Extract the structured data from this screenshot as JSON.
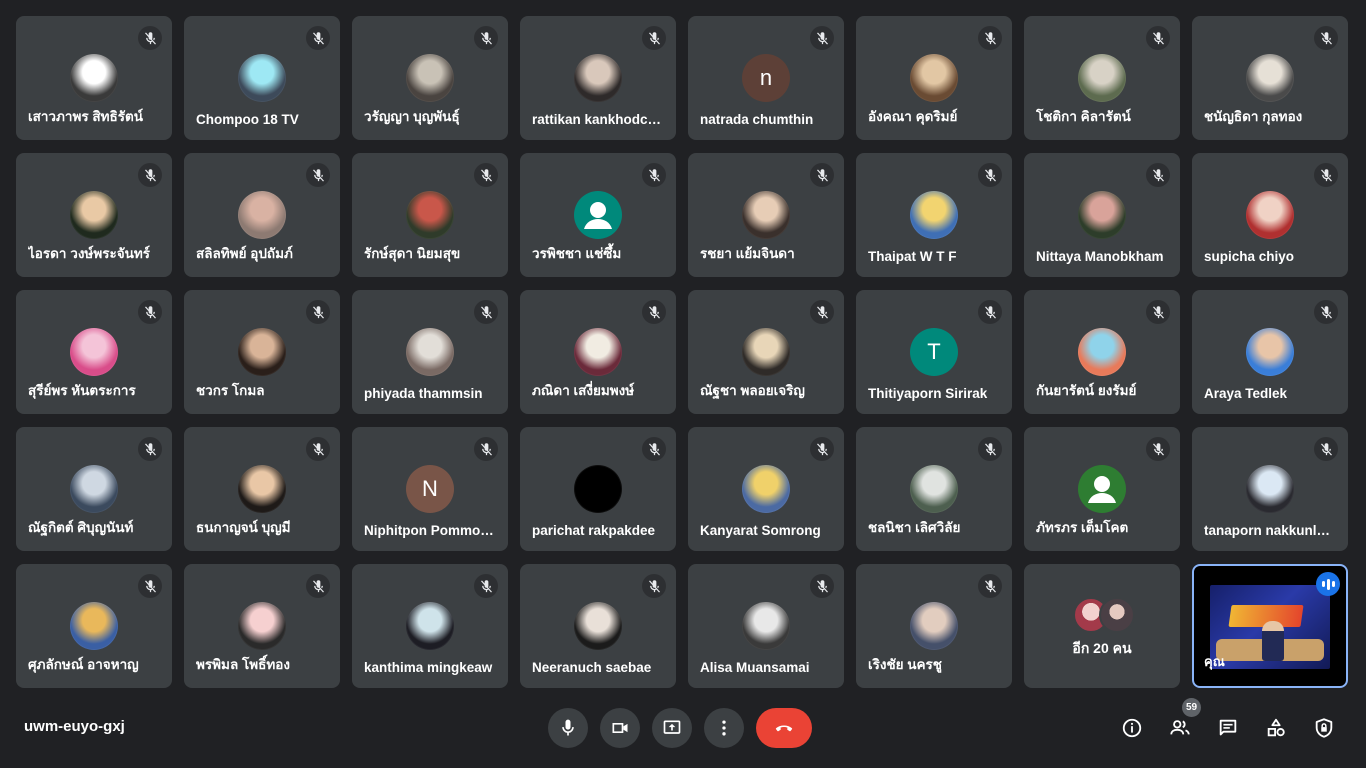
{
  "participants": [
    {
      "name": "เสาวภาพร สิทธิรัตน์",
      "avatar_style": "photo",
      "colors": [
        "#ffffff",
        "#3a3a3a"
      ]
    },
    {
      "name": "Chompoo 18 TV",
      "avatar_style": "photo",
      "colors": [
        "#9ee8f4",
        "#3d4a5a"
      ]
    },
    {
      "name": "วรัญญา บุญพันธุ์",
      "avatar_style": "photo",
      "colors": [
        "#c9c2b6",
        "#4a4440"
      ]
    },
    {
      "name": "rattikan kankhodchai",
      "avatar_style": "photo",
      "colors": [
        "#d9c8bb",
        "#2e2a2a"
      ]
    },
    {
      "name": "natrada chumthin",
      "avatar_style": "letter",
      "letter": "n",
      "colors": [
        "#5d4037",
        "#5d4037"
      ]
    },
    {
      "name": "อังคณา คุดริมย์",
      "avatar_style": "photo",
      "colors": [
        "#e2c7a4",
        "#6a4b33"
      ]
    },
    {
      "name": "โชติกา คิลารัตน์",
      "avatar_style": "photo",
      "colors": [
        "#d8d2c6",
        "#5d6b4f"
      ]
    },
    {
      "name": "ชนัญธิดา กุลทอง",
      "avatar_style": "photo",
      "colors": [
        "#e6e0d6",
        "#4a4a4a"
      ]
    },
    {
      "name": "ไอรดา วงษ์พระจันทร์",
      "avatar_style": "photo",
      "colors": [
        "#e9c9a5",
        "#1f2a1e"
      ]
    },
    {
      "name": "สลิลทิพย์ อุปถัมภ์",
      "avatar_style": "photo",
      "colors": [
        "#d9b2a3",
        "#8d7a72"
      ]
    },
    {
      "name": "รักษ์สุดา นิยมสุข",
      "avatar_style": "photo",
      "colors": [
        "#c9574a",
        "#2f3b2a"
      ]
    },
    {
      "name": "วรพิชชา แช่ซึ้ม",
      "avatar_style": "default",
      "colors": [
        "#00897b",
        "#00897b"
      ]
    },
    {
      "name": "รชยา แย้มจินดา",
      "avatar_style": "photo",
      "colors": [
        "#e7cdb6",
        "#3a302c"
      ]
    },
    {
      "name": "Thaipat W T F",
      "avatar_style": "photo",
      "colors": [
        "#f2d470",
        "#3f6fb5"
      ]
    },
    {
      "name": "Nittaya Manobkham",
      "avatar_style": "photo",
      "colors": [
        "#d9a39a",
        "#2d3d2a"
      ]
    },
    {
      "name": "supicha chiyo",
      "avatar_style": "photo",
      "colors": [
        "#f0d2c5",
        "#b03030"
      ]
    },
    {
      "name": "สุรีย์พร หันตระการ",
      "avatar_style": "photo",
      "colors": [
        "#f4c4d8",
        "#d94d8a"
      ]
    },
    {
      "name": "ชวกร โกมล",
      "avatar_style": "photo",
      "colors": [
        "#d9b498",
        "#2a1f1a"
      ]
    },
    {
      "name": "phiyada thammsin",
      "avatar_style": "photo",
      "colors": [
        "#e2ded8",
        "#7a6a64"
      ]
    },
    {
      "name": "ภณิดา เสงี่ยมพงษ์",
      "avatar_style": "photo",
      "colors": [
        "#f1ece2",
        "#6b2a3a"
      ]
    },
    {
      "name": "ณัฐชา พลอยเจริญ",
      "avatar_style": "photo",
      "colors": [
        "#e8d6b8",
        "#2f2b28"
      ]
    },
    {
      "name": "Thitiyaporn Sirirak",
      "avatar_style": "letter",
      "letter": "T",
      "colors": [
        "#00897b",
        "#00897b"
      ]
    },
    {
      "name": "กันยารัตน์ ยงรัมย์",
      "avatar_style": "photo",
      "colors": [
        "#8fd3ea",
        "#e87a5a"
      ]
    },
    {
      "name": "Araya Tedlek",
      "avatar_style": "photo",
      "colors": [
        "#e8c5a8",
        "#3a7ed8"
      ]
    },
    {
      "name": "ณัฐกิตต์ ศิบุญนันท์",
      "avatar_style": "photo",
      "colors": [
        "#cfd8e2",
        "#3b4a5e"
      ]
    },
    {
      "name": "ธนกาญจน์ บุญมี",
      "avatar_style": "photo",
      "colors": [
        "#e9c7a6",
        "#1e1a18"
      ]
    },
    {
      "name": "Niphitpon Pommongkol",
      "avatar_style": "letter",
      "letter": "N",
      "colors": [
        "#795548",
        "#795548"
      ]
    },
    {
      "name": "parichat rakpakdee",
      "avatar_style": "photo",
      "colors": [
        "#000000",
        "#000000"
      ]
    },
    {
      "name": "Kanyarat Somrong",
      "avatar_style": "photo",
      "colors": [
        "#f0d16a",
        "#4b6aa3"
      ]
    },
    {
      "name": "ชลนิชา เลิศวิลัย",
      "avatar_style": "photo",
      "colors": [
        "#e0e3e0",
        "#4d5f4f"
      ]
    },
    {
      "name": "ภัทรภร เต็มโคต",
      "avatar_style": "default",
      "colors": [
        "#2e7d32",
        "#2e7d32"
      ]
    },
    {
      "name": "tanaporn nakkunlong",
      "avatar_style": "photo",
      "colors": [
        "#dbe8f4",
        "#2a2a30"
      ]
    },
    {
      "name": "ศุภลักษณ์ อาจหาญ",
      "avatar_style": "photo",
      "colors": [
        "#e9b85b",
        "#3a5fa4"
      ]
    },
    {
      "name": "พรพิมล โพธิ์ทอง",
      "avatar_style": "photo",
      "colors": [
        "#f6d0d0",
        "#2a2a2a"
      ]
    },
    {
      "name": "kanthima mingkeaw",
      "avatar_style": "photo",
      "colors": [
        "#cfe3ea",
        "#1d1d24"
      ]
    },
    {
      "name": "Neeranuch saebae",
      "avatar_style": "photo",
      "colors": [
        "#e9e0d8",
        "#1b1b1b"
      ]
    },
    {
      "name": "Alisa Muansamai",
      "avatar_style": "photo",
      "colors": [
        "#e8e8e8",
        "#3a3a3a"
      ]
    },
    {
      "name": "เริงชัย นครชู",
      "avatar_style": "photo",
      "colors": [
        "#e2cdbf",
        "#45506a"
      ]
    }
  ],
  "more_participants": {
    "label": "อีก 20 คน"
  },
  "self_tile": {
    "label": "คุณ"
  },
  "meeting": {
    "code": "uwm-euyo-gxj"
  },
  "people_count": "59",
  "icons": {
    "mute": "mic-off-icon",
    "mic": "microphone-icon",
    "camera": "videocam-icon",
    "present": "present-screen-icon",
    "more": "more-vert-icon",
    "end": "call-end-icon",
    "info": "info-icon",
    "people": "people-icon",
    "chat": "chat-icon",
    "activities": "activities-icon",
    "host": "host-controls-icon"
  },
  "colors": {
    "background": "#202124",
    "tile": "#3c4043",
    "end_call": "#ea4335",
    "accent": "#8ab4f8"
  }
}
